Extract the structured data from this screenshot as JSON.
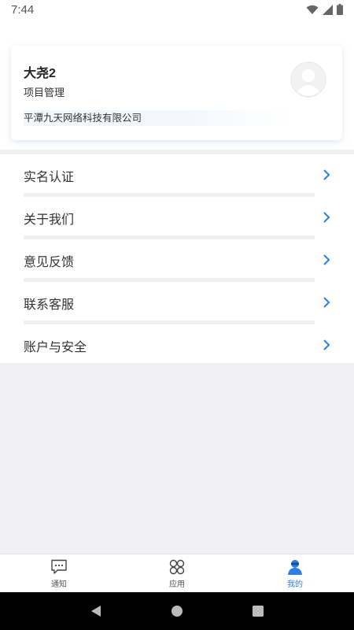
{
  "status_bar": {
    "time": "7:44"
  },
  "profile": {
    "name": "大尧2",
    "role": "项目管理",
    "company": "平潭九天网络科技有限公司"
  },
  "menu": {
    "items": [
      {
        "label": "实名认证"
      },
      {
        "label": "关于我们"
      },
      {
        "label": "意见反馈"
      },
      {
        "label": "联系客服"
      },
      {
        "label": "账户与安全"
      }
    ]
  },
  "tabbar": {
    "tabs": [
      {
        "label": "通知",
        "icon": "chat-icon",
        "active": false
      },
      {
        "label": "应用",
        "icon": "apps-icon",
        "active": false
      },
      {
        "label": "我的",
        "icon": "user-icon",
        "active": true
      }
    ]
  },
  "colors": {
    "accent": "#2f7fe0",
    "background": "#f0f0f3"
  }
}
